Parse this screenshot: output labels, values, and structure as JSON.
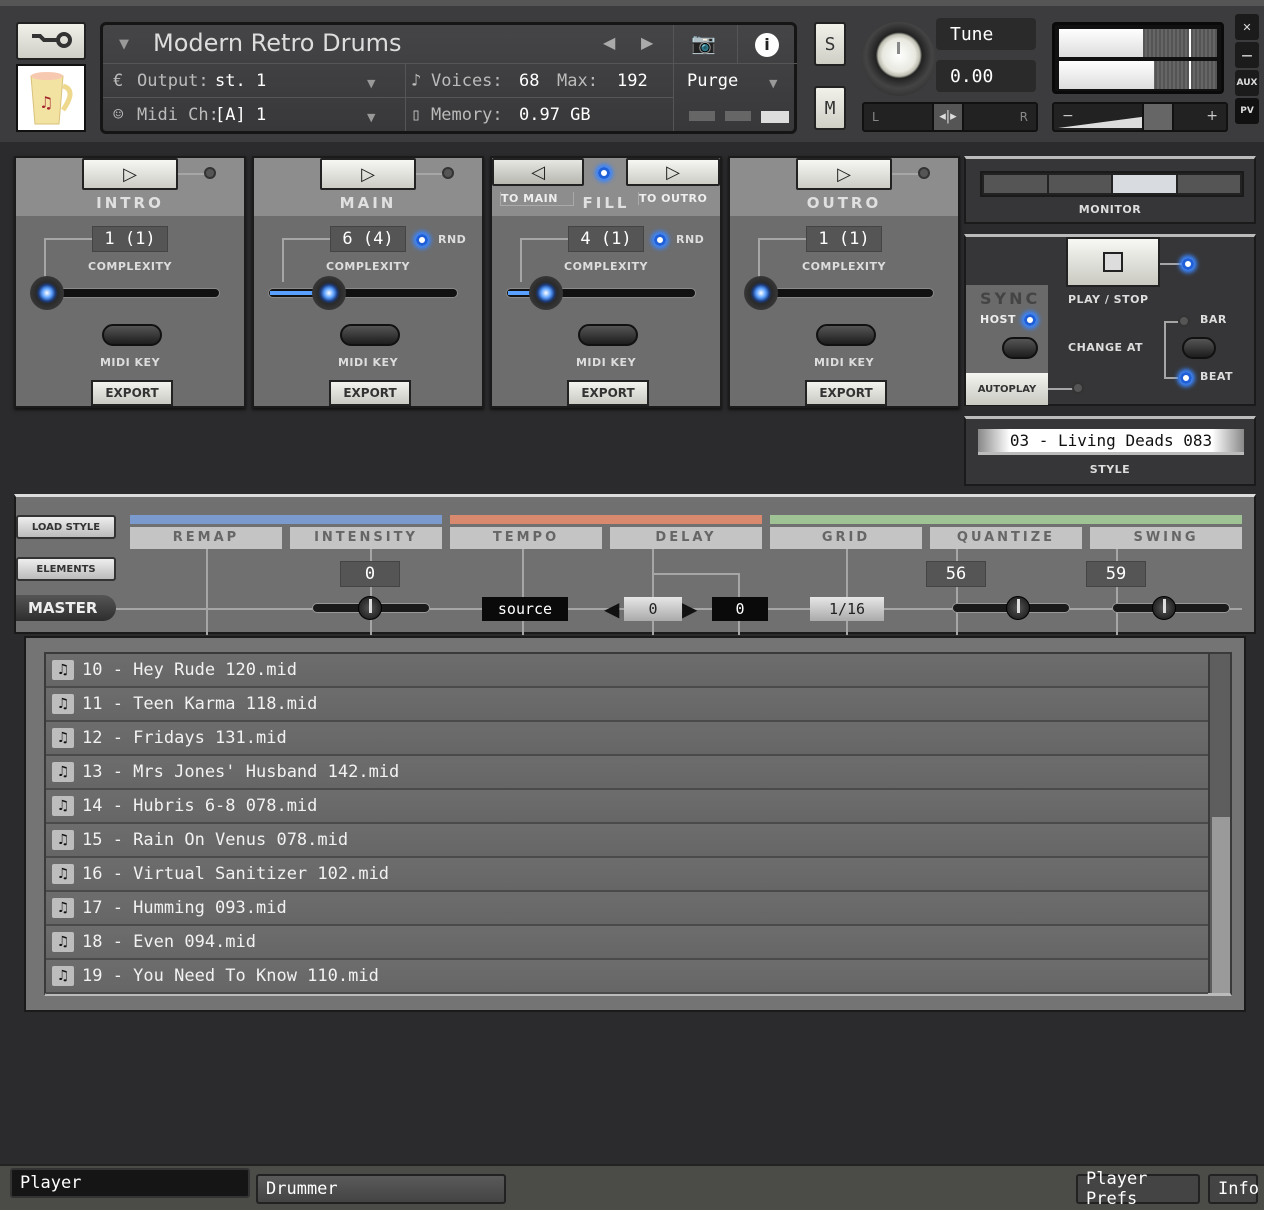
{
  "header": {
    "instrument_name": "Modern Retro Drums",
    "output_label": "Output:",
    "output_value": "st. 1",
    "midi_label": "Midi Ch:",
    "midi_value": "[A]  1",
    "voices_label": "Voices:",
    "voices_value": "68",
    "max_label": "Max:",
    "max_value": "192",
    "memory_label": "Memory:",
    "memory_value": "0.97 GB",
    "purge_label": "Purge",
    "solo_label": "S",
    "mute_label": "M",
    "tune_label": "Tune",
    "tune_value": "0.00",
    "pan_left": "L",
    "pan_right": "R",
    "vol_minus": "−",
    "vol_plus": "+",
    "meter_levels": [
      0.53,
      0.6
    ],
    "meter_peaks": [
      0.82,
      0.82
    ],
    "close_label": "✕",
    "minimize_label": "—",
    "aux_label": "AUX",
    "pv_label": "PV"
  },
  "sections": [
    {
      "title": "INTRO",
      "complexity_value": "1 (1)",
      "complexity_label": "COMPLEXITY",
      "rnd": false,
      "complexity_level": 0.0,
      "midi_key_label": "MIDI KEY",
      "export_label": "EXPORT",
      "active": false
    },
    {
      "title": "MAIN",
      "complexity_value": "6 (4)",
      "complexity_label": "COMPLEXITY",
      "rnd": true,
      "rnd_label": "RND",
      "complexity_level": 0.28,
      "midi_key_label": "MIDI KEY",
      "export_label": "EXPORT",
      "active": false
    },
    {
      "title": "FILL",
      "complexity_value": "4 (1)",
      "complexity_label": "COMPLEXITY",
      "rnd": true,
      "rnd_label": "RND",
      "complexity_level": 0.15,
      "midi_key_label": "MIDI KEY",
      "export_label": "EXPORT",
      "active": true,
      "to_main_label": "TO MAIN",
      "to_outro_label": "TO OUTRO"
    },
    {
      "title": "OUTRO",
      "complexity_value": "1 (1)",
      "complexity_label": "COMPLEXITY",
      "rnd": false,
      "complexity_level": 0.0,
      "midi_key_label": "MIDI KEY",
      "export_label": "EXPORT",
      "active": false
    }
  ],
  "monitor": {
    "label": "MONITOR",
    "active_index": 2,
    "segments": 4
  },
  "transport": {
    "play_stop_label": "PLAY / STOP",
    "sync_label": "SYNC",
    "host_label": "HOST",
    "change_at_label": "CHANGE AT",
    "bar_label": "BAR",
    "beat_label": "BEAT",
    "autoplay_label": "AUTOPLAY",
    "selected_change": "BEAT"
  },
  "style": {
    "value": "03 - Living Deads 083",
    "label": "STYLE"
  },
  "params": {
    "load_style_label": "LOAD STYLE",
    "elements_label": "ELEMENTS",
    "master_label": "MASTER",
    "tabs": [
      "REMAP",
      "INTENSITY",
      "TEMPO",
      "DELAY",
      "GRID",
      "QUANTIZE",
      "SWING"
    ],
    "group_colors": {
      "blue": "#7b9bcf",
      "orange": "#d98a6e",
      "green": "#9fc394"
    },
    "intensity_value": "0",
    "tempo_value": "source",
    "delay_value": "0",
    "delay_value2": "0",
    "grid_value": "1/16",
    "quantize_value": "56",
    "swing_value": "59"
  },
  "file_list": [
    "10 - Hey Rude 120.mid",
    "11 - Teen Karma 118.mid",
    "12 - Fridays 131.mid",
    "13 - Mrs Jones' Husband 142.mid",
    "14 - Hubris 6-8 078.mid",
    "15 - Rain On Venus 078.mid",
    "16 - Virtual Sanitizer 102.mid",
    "17 - Humming 093.mid",
    "18 - Even 094.mid",
    "19 - You Need To Know 110.mid"
  ],
  "scroll": {
    "position": 0.48,
    "visible_fraction": 0.52
  },
  "footer": {
    "tab_player": "Player",
    "tab_drummer": "Drummer",
    "player_prefs": "Player Prefs",
    "info": "Info"
  }
}
